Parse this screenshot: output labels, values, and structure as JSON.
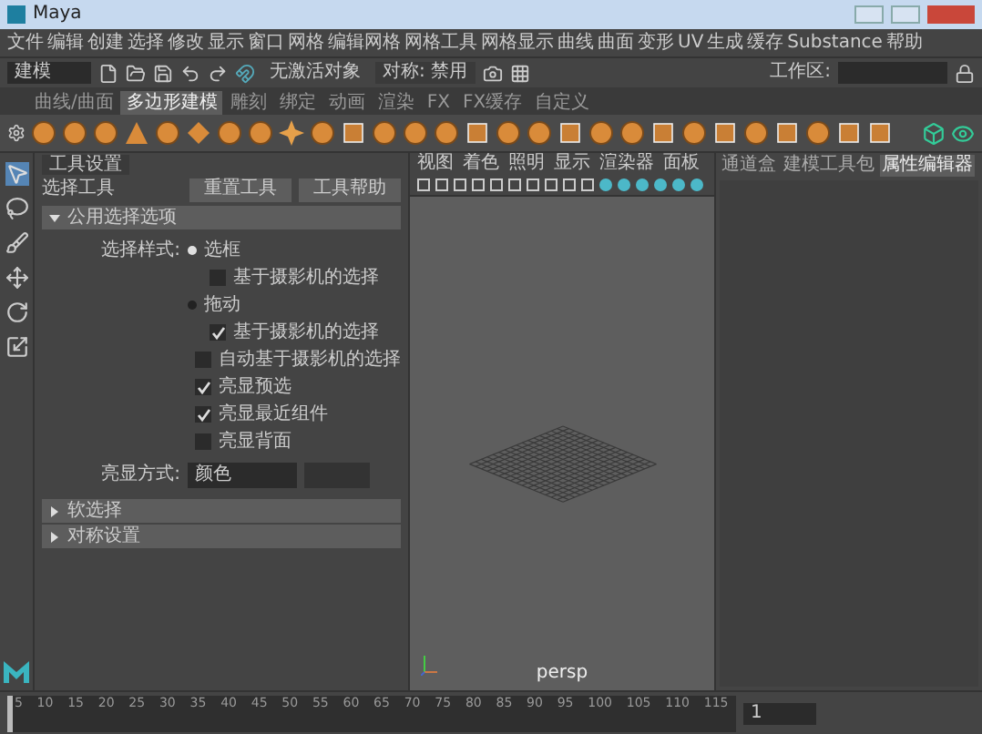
{
  "window": {
    "title": "Maya"
  },
  "menu_bar": [
    "文件",
    "编辑",
    "创建",
    "选择",
    "修改",
    "显示",
    "窗口",
    "网格",
    "编辑网格",
    "网格工具",
    "网格显示",
    "曲线",
    "曲面",
    "变形",
    "UV",
    "生成",
    "缓存",
    "Substance",
    "帮助"
  ],
  "status_line": {
    "mode": "建模",
    "object": "无激活对象",
    "symmetry": "对称: 禁用",
    "workspace_label": "工作区:"
  },
  "shelf_tabs": [
    {
      "label": "曲线/曲面",
      "selected": false
    },
    {
      "label": "多边形建模",
      "selected": true
    },
    {
      "label": "雕刻",
      "selected": false
    },
    {
      "label": "绑定",
      "selected": false
    },
    {
      "label": "动画",
      "selected": false
    },
    {
      "label": "渲染",
      "selected": false
    },
    {
      "label": "FX",
      "selected": false
    },
    {
      "label": "FX缓存",
      "selected": false
    },
    {
      "label": "自定义",
      "selected": false
    }
  ],
  "tool_settings": {
    "tab": "工具设置",
    "tool_name": "选择工具",
    "buttons": [
      "重置工具",
      "工具帮助"
    ],
    "sections": [
      {
        "title": "公用选择选项",
        "expanded": true,
        "rows": [
          {
            "kind": "radio",
            "label": "选择样式:",
            "option": "选框",
            "selected": true,
            "children": [
              {
                "kind": "checkbox",
                "label": "基于摄影机的选择",
                "checked": false
              }
            ]
          },
          {
            "kind": "radio",
            "option": "拖动",
            "selected": false,
            "children": [
              {
                "kind": "checkbox",
                "label": "基于摄影机的选择",
                "checked": true
              }
            ]
          },
          {
            "kind": "checkbox",
            "label": "自动基于摄影机的选择",
            "checked": false
          },
          {
            "kind": "checkbox",
            "label": "亮显预选",
            "checked": true
          },
          {
            "kind": "checkbox",
            "label": "亮显最近组件",
            "checked": true
          },
          {
            "kind": "checkbox",
            "label": "亮显背面",
            "checked": false
          },
          {
            "kind": "dropdown",
            "label": "亮显方式:",
            "value": "颜色"
          }
        ]
      },
      {
        "title": "软选择",
        "expanded": false
      },
      {
        "title": "对称设置",
        "expanded": false
      }
    ]
  },
  "viewport": {
    "menu": [
      "视图",
      "着色",
      "照明",
      "显示",
      "渲染器",
      "面板"
    ],
    "camera": "persp"
  },
  "right_panel": {
    "tabs": [
      {
        "label": "通道盒",
        "selected": false
      },
      {
        "label": "建模工具包",
        "selected": false
      },
      {
        "label": "属性编辑器",
        "selected": true
      }
    ]
  },
  "timeline": {
    "ticks": [
      "5",
      "10",
      "15",
      "20",
      "25",
      "30",
      "35",
      "40",
      "45",
      "50",
      "55",
      "60",
      "65",
      "70",
      "75",
      "80",
      "85",
      "90",
      "95",
      "100",
      "105",
      "110",
      "115"
    ],
    "current_frame": "1",
    "level": 0.0
  }
}
